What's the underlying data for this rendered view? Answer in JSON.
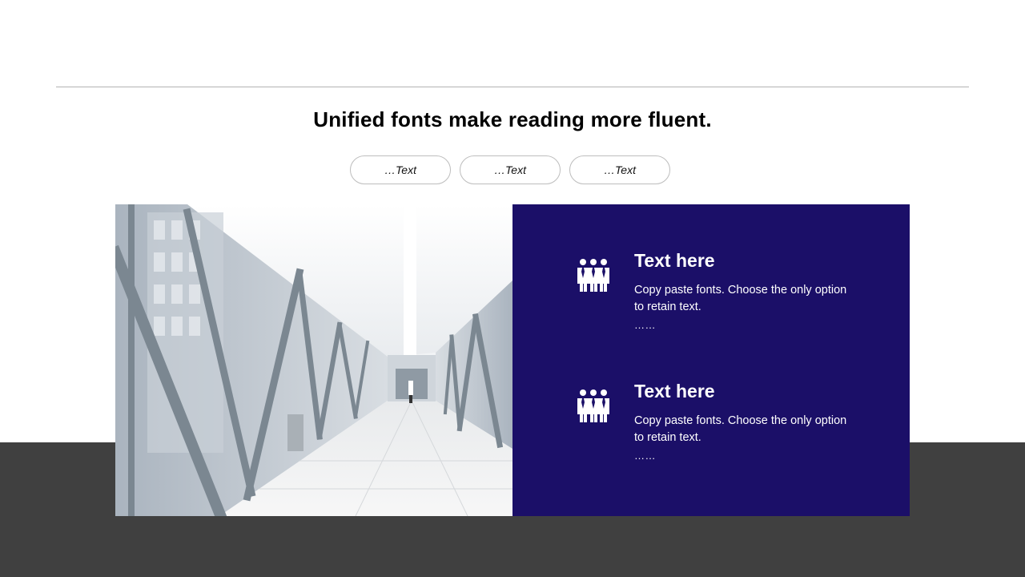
{
  "slide": {
    "title": "Unified fonts make reading more fluent.",
    "tabs": [
      {
        "label": "…Text"
      },
      {
        "label": "…Text"
      },
      {
        "label": "…Text"
      }
    ],
    "photo_icon": "corridor-photo",
    "items": [
      {
        "icon": "people-group-icon",
        "title": "Text here",
        "body": "Copy paste fonts. Choose the only option to retain text.",
        "more": "……"
      },
      {
        "icon": "people-group-icon",
        "title": "Text here",
        "body": "Copy paste fonts. Choose the only option to retain text.",
        "more": "……"
      }
    ]
  },
  "colors": {
    "panel": "#1b0f68",
    "band": "#404040",
    "rule": "#b3b3b3"
  }
}
